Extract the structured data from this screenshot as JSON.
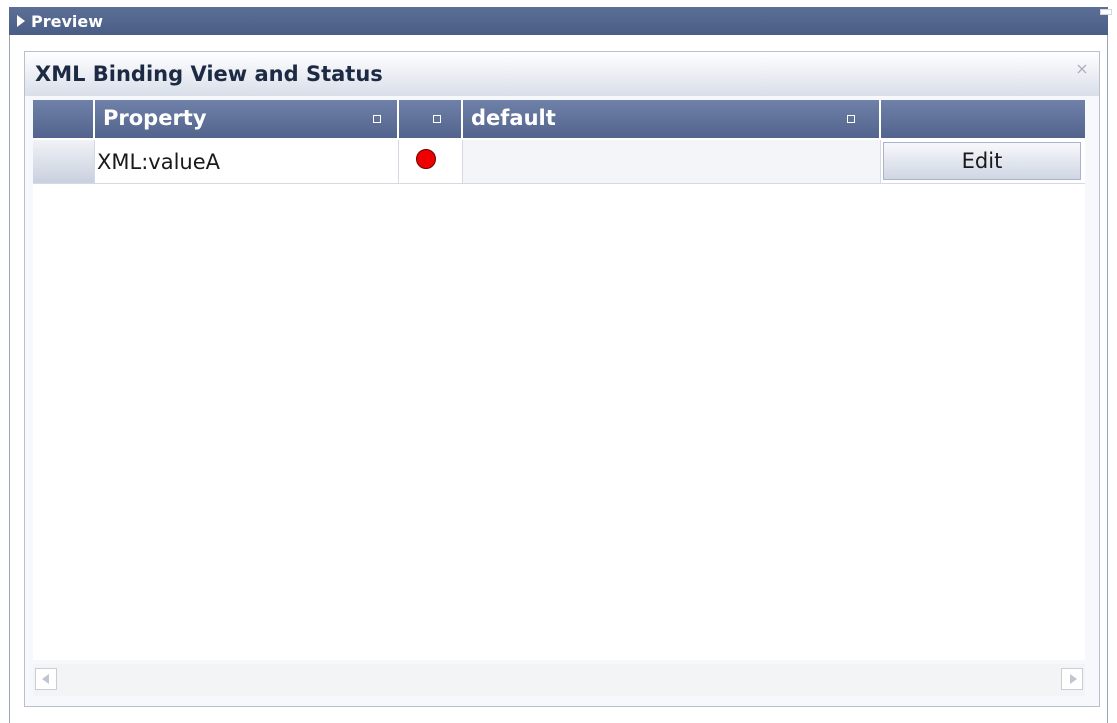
{
  "preview": {
    "title": "Preview"
  },
  "panel": {
    "title": "XML Binding View and Status"
  },
  "grid": {
    "columns": [
      {
        "label": ""
      },
      {
        "label": "Property"
      },
      {
        "label": ""
      },
      {
        "label": "default"
      },
      {
        "label": ""
      }
    ],
    "rows": [
      {
        "property": "XML:valueA",
        "status": "red",
        "default": "",
        "action_label": "Edit"
      }
    ]
  },
  "colors": {
    "status_red": "#ee0000",
    "header_blue": "#5c6f96"
  },
  "icons": {
    "preview_toggle": "triangle-right-icon",
    "close": "close-icon",
    "sort": "sort-icon",
    "status": "status-dot-icon",
    "scroll_left": "scroll-left-icon",
    "scroll_right": "scroll-right-icon"
  }
}
